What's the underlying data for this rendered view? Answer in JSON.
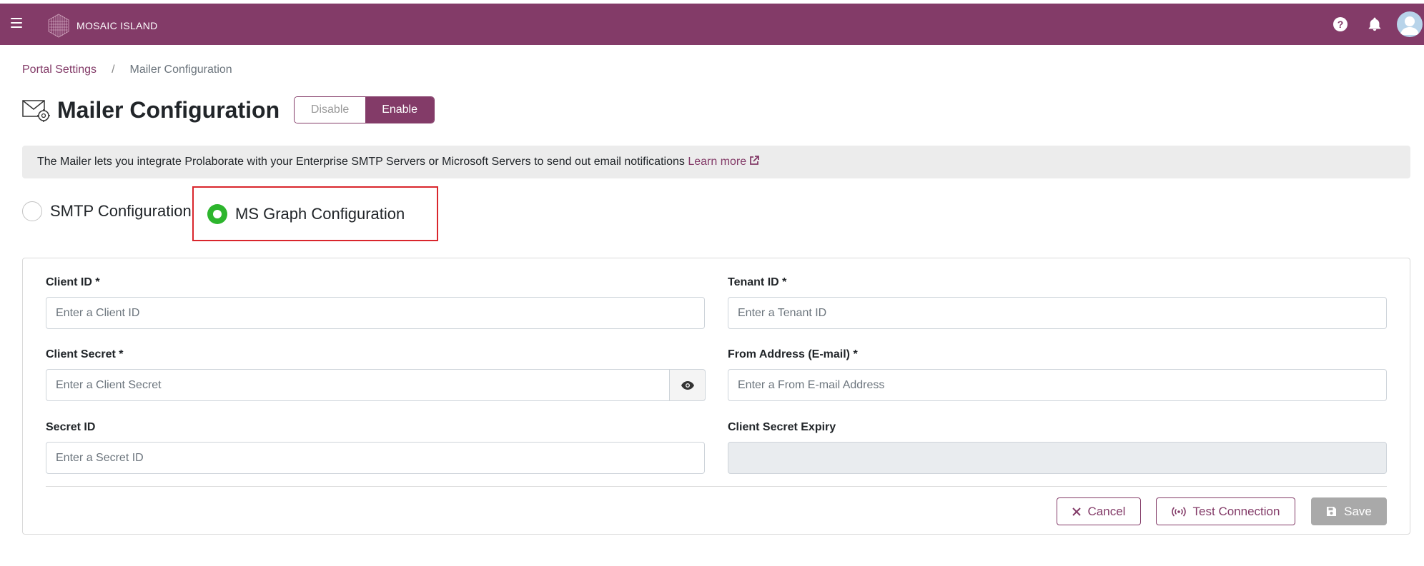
{
  "header": {
    "brand": "MOSAIC ISLAND",
    "help_glyph": "?",
    "icons": [
      "menu-icon",
      "help-icon",
      "bell-icon",
      "avatar-icon"
    ],
    "accent_color": "#833b68"
  },
  "breadcrumb": {
    "parent": "Portal Settings",
    "separator": "/",
    "current": "Mailer Configuration"
  },
  "page": {
    "title": "Mailer Configuration",
    "toggle": {
      "disable_label": "Disable",
      "enable_label": "Enable",
      "selected": "Enable"
    }
  },
  "info": {
    "text": "The Mailer lets you integrate Prolaborate with your Enterprise SMTP Servers or Microsoft Servers to send out email notifications",
    "link_label": "Learn more"
  },
  "config_type": {
    "options": [
      "SMTP Configuration",
      "MS Graph Configuration"
    ],
    "selected": "MS Graph Configuration",
    "selected_color": "#2db52d"
  },
  "form": {
    "client_id": {
      "label": "Client ID *",
      "placeholder": "Enter a Client ID"
    },
    "tenant_id": {
      "label": "Tenant ID *",
      "placeholder": "Enter a Tenant ID"
    },
    "client_secret": {
      "label": "Client Secret *",
      "placeholder": "Enter a Client Secret"
    },
    "from_address": {
      "label": "From Address (E-mail) *",
      "placeholder": "Enter a From E-mail Address"
    },
    "secret_id": {
      "label": "Secret ID",
      "placeholder": "Enter a Secret ID"
    },
    "client_secret_expiry": {
      "label": "Client Secret Expiry",
      "value": ""
    }
  },
  "actions": {
    "cancel_label": "Cancel",
    "test_label": "Test Connection",
    "save_label": "Save"
  }
}
